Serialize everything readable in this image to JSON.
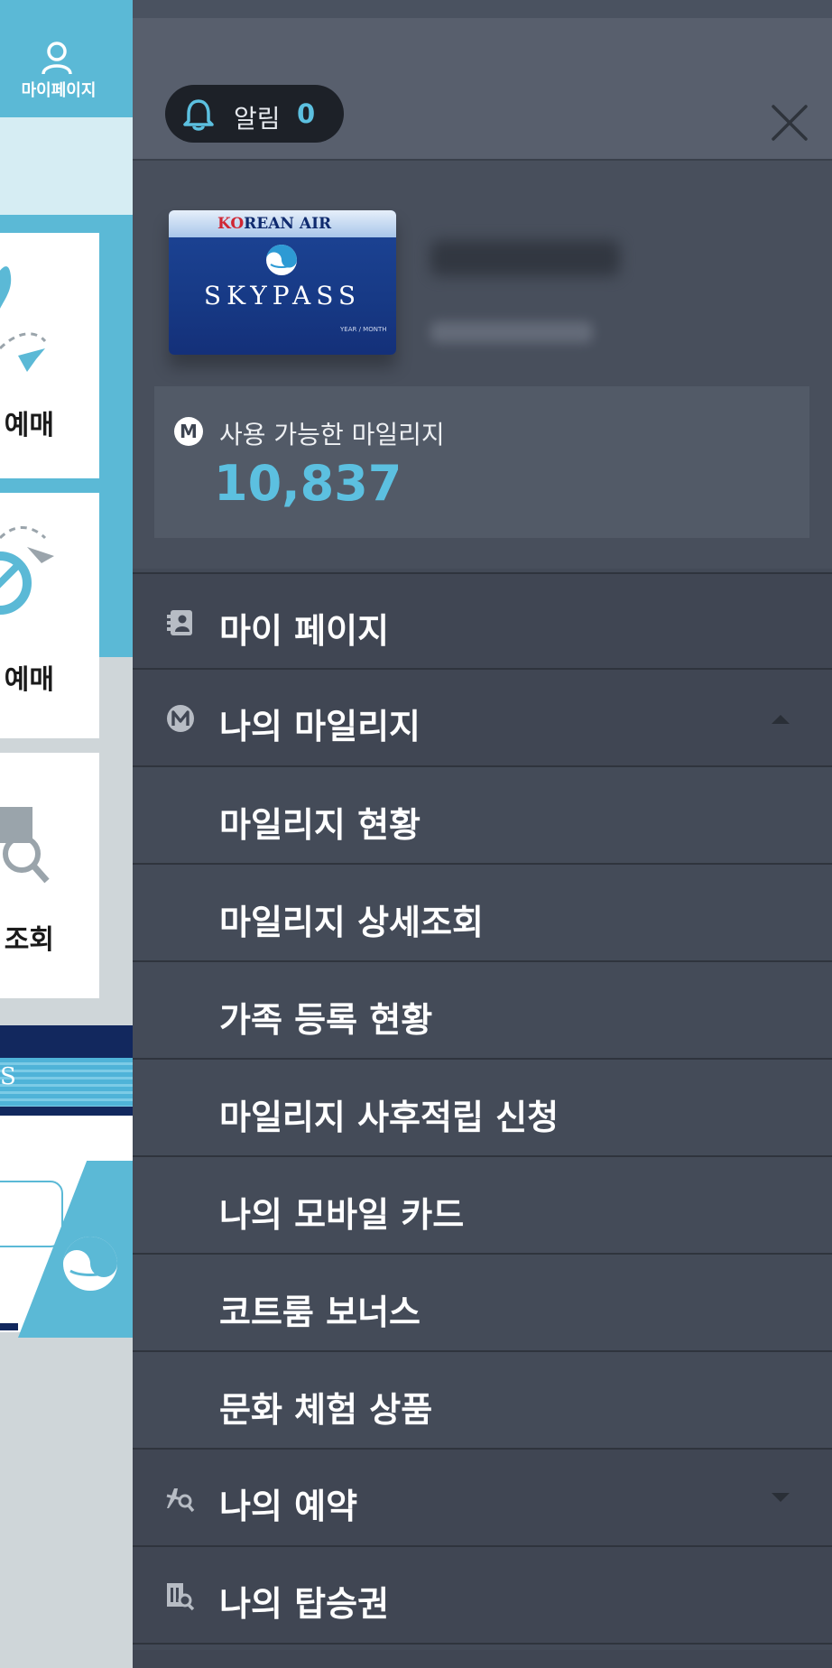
{
  "background": {
    "mypage_label": "마이페이지",
    "cards": [
      {
        "label": "예매"
      },
      {
        "label": "예매"
      },
      {
        "label": "조회"
      }
    ],
    "stripe_text": "S"
  },
  "drawer": {
    "alarm": {
      "label": "알림",
      "count": "0"
    },
    "card": {
      "brand_k": "K",
      "brand_rest": "REAN AIR",
      "brand_o": "O",
      "product": "SKYPASS",
      "small_text": "YEAR / MONTH"
    },
    "mileage": {
      "badge": "M",
      "label": "사용 가능한 마일리지",
      "value": "10,837"
    },
    "menu": [
      {
        "label": "마이 페이지",
        "icon": "contact-book-icon"
      },
      {
        "label": "나의 마일리지",
        "icon": "mileage-m-icon",
        "expanded": true
      },
      {
        "label": "마일리지 현황"
      },
      {
        "label": "마일리지 상세조회"
      },
      {
        "label": "가족 등록 현황"
      },
      {
        "label": "마일리지 사후적립 신청"
      },
      {
        "label": "나의 모바일 카드"
      },
      {
        "label": "코트룸 보너스"
      },
      {
        "label": "문화 체험 상품"
      },
      {
        "label": "나의 예약",
        "icon": "plane-search-icon",
        "expanded": false
      },
      {
        "label": "나의 탑승권",
        "icon": "ticket-search-icon"
      }
    ]
  },
  "colors": {
    "accent": "#5cc0e0",
    "drawer_bg": "#434a57",
    "header_bg": "#585f6d",
    "brand_blue": "#1d4597"
  }
}
